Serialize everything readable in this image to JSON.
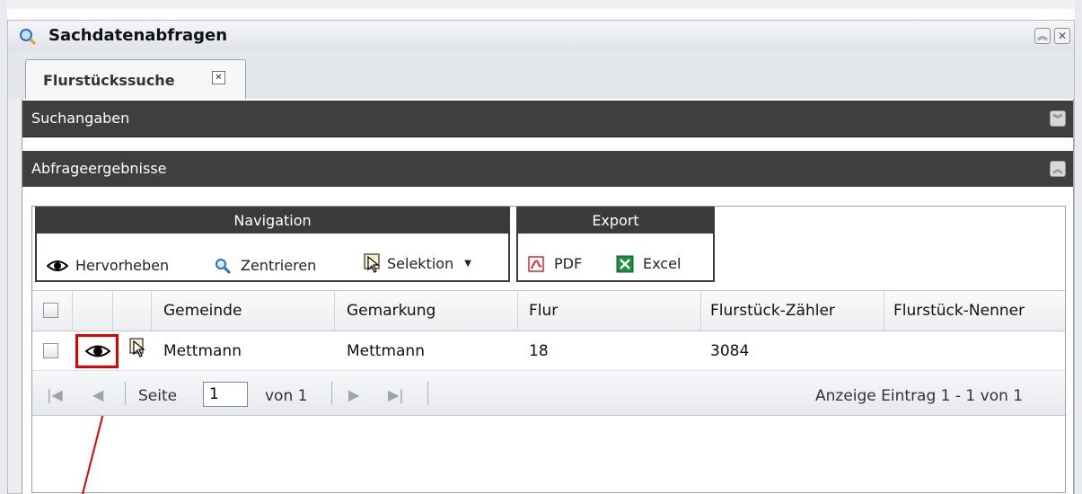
{
  "window": {
    "title": "Sachdatenabfragen",
    "title_icon": "search-magnifier-icon",
    "buttons": [
      {
        "icon": "collapse-up-icon",
        "glyph": "︽"
      },
      {
        "icon": "close-icon",
        "glyph": "✕"
      }
    ]
  },
  "tabs": [
    {
      "label": "Flurstückssuche",
      "close_glyph": "✕"
    }
  ],
  "sections": {
    "search": {
      "label": "Suchangaben",
      "toggle_glyph": "︾"
    },
    "results": {
      "label": "Abfrageergebnisse",
      "toggle_glyph": "︽"
    }
  },
  "toolbar": {
    "navigation": {
      "title": "Navigation",
      "highlight": "Hervorheben",
      "center": "Zentrieren",
      "selection": "Selektion"
    },
    "export": {
      "title": "Export",
      "pdf": "PDF",
      "excel": "Excel"
    }
  },
  "table": {
    "columns": [
      "Gemeinde",
      "Gemarkung",
      "Flur",
      "Flurstück-Zähler",
      "Flurstück-Nenner"
    ],
    "rows": [
      {
        "gemeinde": "Mettmann",
        "gemarkung": "Mettmann",
        "flur": "18",
        "zaehler": "3084",
        "nenner": ""
      }
    ]
  },
  "pager": {
    "page_label": "Seite",
    "page_value": "1",
    "of_label": "von 1",
    "status": "Anzeige Eintrag 1 - 1 von 1"
  },
  "colors": {
    "section_bg": "#3f3f3f",
    "highlight": "#e00000",
    "pdf_red": "#d32f2f",
    "excel_green": "#1e8e3e"
  }
}
